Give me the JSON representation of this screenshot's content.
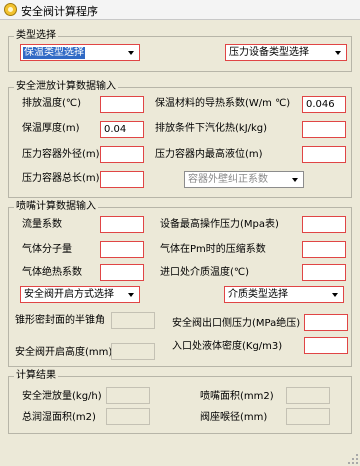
{
  "window": {
    "title": "安全阀计算程序",
    "icon": "app-icon"
  },
  "type_select": {
    "legend": "类型选择",
    "left_combo": "保温类型选择",
    "right_combo": "压力设备类型选择"
  },
  "discharge": {
    "legend": "安全泄放计算数据输入",
    "discharge_temp": {
      "label": "排放温度(℃)",
      "value": ""
    },
    "insulation_thickness": {
      "label": "保温厚度(m)",
      "value": "0.04"
    },
    "vessel_od": {
      "label": "压力容器外径(m)",
      "value": ""
    },
    "vessel_length": {
      "label": "压力容器总长(m)",
      "value": ""
    },
    "thermal_conductivity": {
      "label": "保温材料的导热系数(W/m ℃)",
      "value": "0.046"
    },
    "latent_heat": {
      "label": "排放条件下汽化热(kJ/kg)",
      "value": ""
    },
    "max_liquid_level": {
      "label": "压力容器内最高液位(m)",
      "value": ""
    },
    "external_correction": "容器外壁纠正系数"
  },
  "nozzle": {
    "legend": "喷嘴计算数据输入",
    "flow_coefficient": {
      "label": "流量系数",
      "value": ""
    },
    "gas_molecular_weight": {
      "label": "气体分子量",
      "value": ""
    },
    "gas_adiabatic_index": {
      "label": "气体绝热系数",
      "value": ""
    },
    "design_max_pressure": {
      "label": "设备最高操作压力(Mpa表)",
      "value": ""
    },
    "compressibility": {
      "label": "气体在Pm时的压缩系数",
      "value": ""
    },
    "inlet_temp": {
      "label": "进口处介质温度(℃)",
      "value": ""
    },
    "valve_open_type": "安全阀开启方式选择",
    "medium_type": "介质类型选择",
    "cone_half_angle": {
      "label": "锥形密封面的半锥角",
      "value": ""
    },
    "valve_lift": {
      "label": "安全阀开启高度(mm)",
      "value": ""
    },
    "outlet_back_pressure": {
      "label": "安全阀出口侧压力(MPa绝压)",
      "value": ""
    },
    "inlet_density": {
      "label": "入口处液体密度(Kg/m3)",
      "value": ""
    }
  },
  "results": {
    "legend": "计算结果",
    "relief_flow": {
      "label": "安全泄放量(kg/h)",
      "value": ""
    },
    "nozzle_area": {
      "label": "喷嘴面积(mm2)",
      "value": ""
    },
    "wetted_area": {
      "label": "总润湿面积(m2)",
      "value": ""
    },
    "seat_diameter": {
      "label": "阀座喉径(mm)",
      "value": ""
    }
  },
  "colors": {
    "background": "#ece9d8",
    "required_border": "#e04545",
    "selection": "#316ac5"
  }
}
